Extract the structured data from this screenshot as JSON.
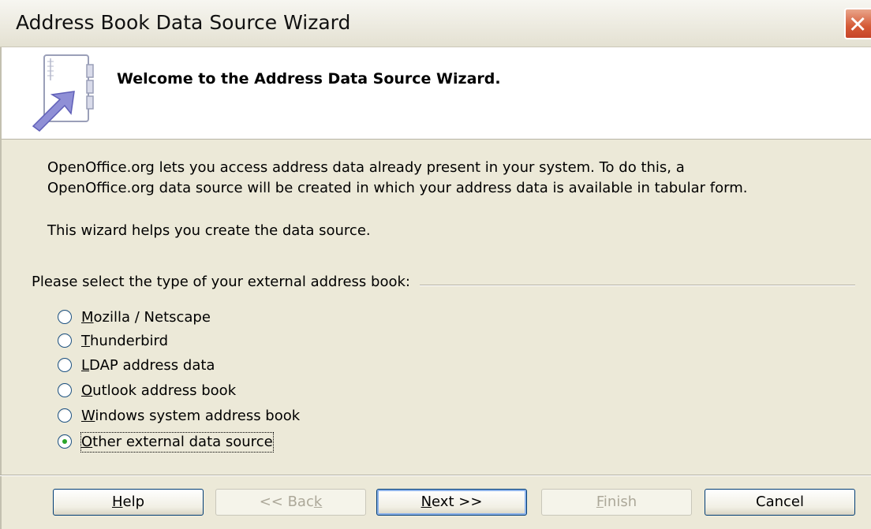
{
  "window": {
    "title": "Address Book Data Source Wizard",
    "close_symbol": "✕"
  },
  "header": {
    "welcome": "Welcome to the Address Data Source Wizard.",
    "icon": "address-book-wizard-icon"
  },
  "intro": {
    "line1": "OpenOffice.org lets you access address data already present in your system. To do this, a",
    "line2": "OpenOffice.org data source will be created in which your address data is available in tabular form.",
    "line3": "This wizard helps you create the data source."
  },
  "address_type": {
    "group_label": "Please select the type of your external address book:",
    "options": [
      {
        "mnemonic": "M",
        "rest": "ozilla / Netscape",
        "checked": false
      },
      {
        "mnemonic": "T",
        "rest": "hunderbird",
        "checked": false
      },
      {
        "mnemonic": "L",
        "rest": "DAP address data",
        "checked": false
      },
      {
        "mnemonic": "O",
        "rest": "utlook address book",
        "checked": false
      },
      {
        "mnemonic": "W",
        "rest": "indows system address book",
        "checked": false
      },
      {
        "mnemonic": "O",
        "rest": "ther external data source",
        "checked": true
      }
    ]
  },
  "buttons": {
    "help": {
      "mnemonic": "H",
      "rest": "elp",
      "enabled": true
    },
    "back": {
      "prefix": "<< Bac",
      "mnemonic": "k",
      "enabled": false
    },
    "next": {
      "mnemonic": "N",
      "rest": "ext >>",
      "enabled": true
    },
    "finish": {
      "mnemonic": "F",
      "rest": "inish",
      "enabled": false
    },
    "cancel": {
      "label": "Cancel",
      "enabled": true
    }
  },
  "colors": {
    "dialog_bg": "#ece9d8",
    "close_button": "#d55a36",
    "radio_checked_dot": "#2ba529",
    "button_border": "#003c74"
  }
}
